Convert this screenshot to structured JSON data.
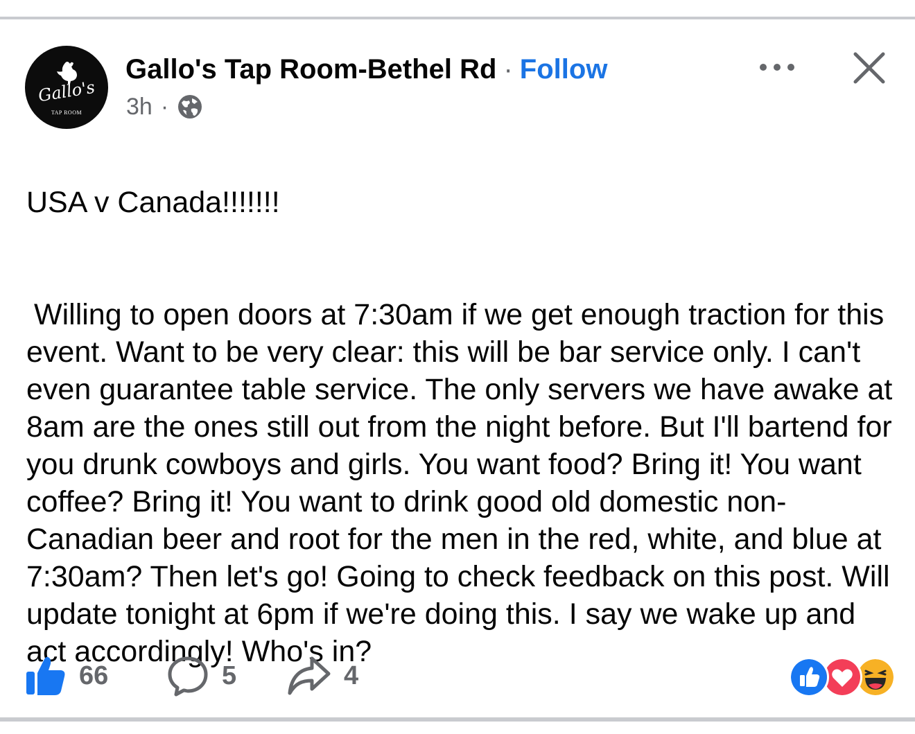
{
  "post": {
    "page_name": "Gallo's Tap Room-Bethel Rd",
    "separator": "·",
    "follow_label": "Follow",
    "timestamp": "3h",
    "meta_separator": "·",
    "audience_icon": "globe-icon",
    "avatar": {
      "logo_text": "Gallo's",
      "logo_subtext": "TAP ROOM",
      "background_color": "#0c0c0c"
    },
    "title": "USA v Canada!!!!!!!",
    "body": "Willing to open doors at 7:30am if we get enough traction for this event. Want to be very clear: this will be bar service only. I can't even guarantee table service. The only servers we have awake at 8am are the ones still out from the night before. But I'll bartend for you drunk cowboys and girls. You want food? Bring it! You want coffee? Bring it! You want to drink good old domestic non-Canadian beer and root for the men in the red, white, and blue at 7:30am? Then let's go! Going to check feedback on this post. Will update tonight at 6pm if we're doing this. I say we wake up and act accordingly! Who's in?"
  },
  "header_actions": {
    "more_icon": "more-horizontal-icon",
    "close_icon": "close-icon"
  },
  "footer": {
    "like_count": "66",
    "comment_count": "5",
    "share_count": "4",
    "reactions": [
      "like",
      "love",
      "haha"
    ]
  },
  "colors": {
    "accent": "#1b74e4",
    "like_blue": "#1877f2",
    "love_red": "#f33e58",
    "haha_yellow": "#f7b125",
    "secondary_text": "#65676b"
  }
}
